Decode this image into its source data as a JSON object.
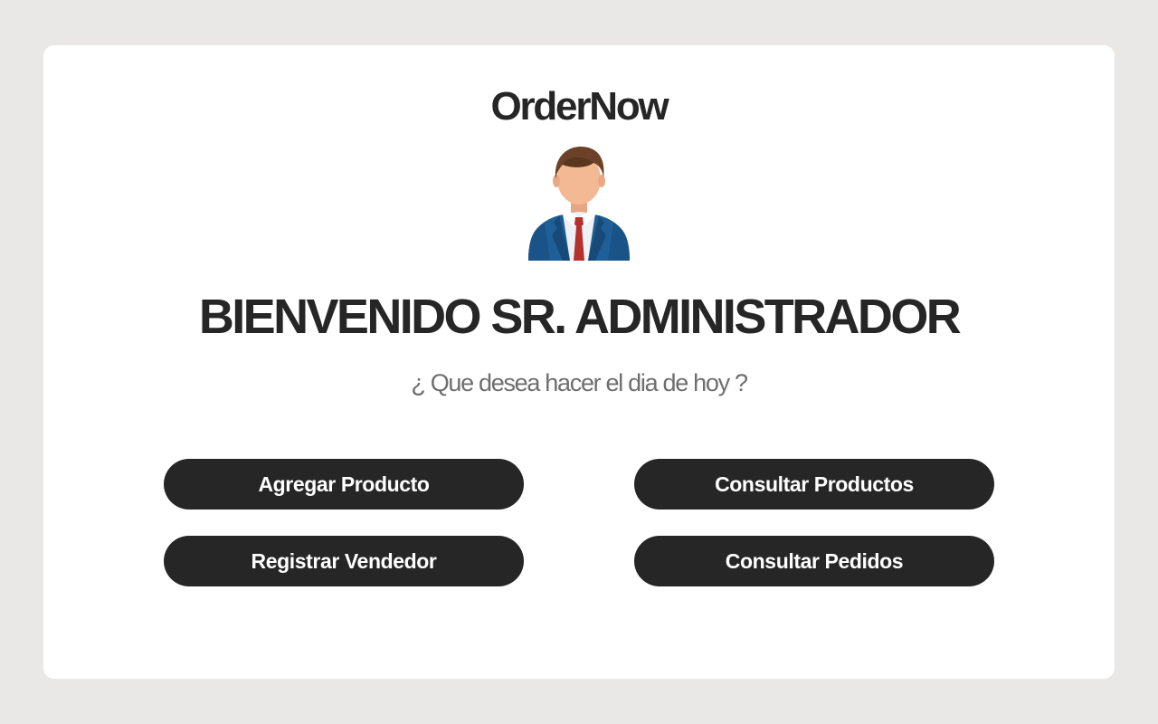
{
  "brand": {
    "name": "OrderNow"
  },
  "welcome": {
    "title": "BIENVENIDO SR. ADMINISTRADOR",
    "subtitle": "¿ Que desea hacer el dia de hoy ?"
  },
  "avatar": {
    "icon": "admin-avatar-icon",
    "colors": {
      "hair": "#6b4228",
      "skin": "#f3b994",
      "suit": "#1f5f97",
      "shirt": "#eef2f7",
      "tie": "#b4322e"
    }
  },
  "actions": {
    "add_product": "Agregar Producto",
    "view_products": "Consultar Productos",
    "register_seller": "Registrar Vendedor",
    "view_orders": "Consultar Pedidos"
  },
  "colors": {
    "background": "#e9e8e6",
    "card": "#ffffff",
    "primary": "#262626",
    "subtitle_text": "#6e6e6e",
    "button_text": "#ffffff"
  }
}
